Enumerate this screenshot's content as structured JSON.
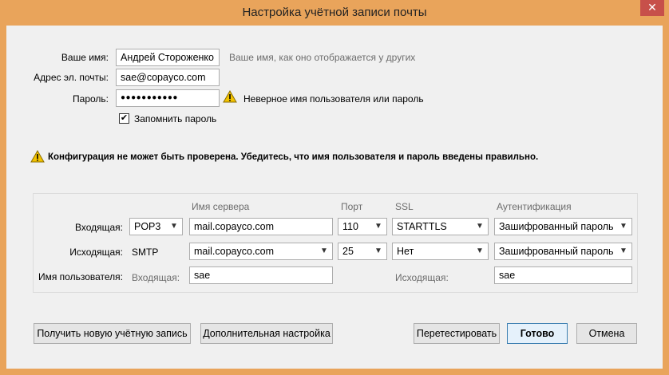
{
  "window": {
    "title": "Настройка учётной записи почты",
    "close_glyph": "✕"
  },
  "identity": {
    "name_label": "Ваше имя:",
    "name_value": "Андрей Стороженко",
    "name_hint": "Ваше имя, как оно отображается у других",
    "email_label": "Адрес эл. почты:",
    "email_value": "sae@copayco.com",
    "password_label": "Пароль:",
    "password_value": "●●●●●●●●●●●",
    "password_error": "Неверное имя пользователя или пароль",
    "remember_label": "Запомнить пароль",
    "remember_checked": true
  },
  "config_warning": "Конфигурация не может быть проверена. Убедитесь, что имя пользователя и пароль введены правильно.",
  "server_table": {
    "headers": {
      "server": "Имя сервера",
      "port": "Порт",
      "ssl": "SSL",
      "auth": "Аутентификация"
    },
    "incoming": {
      "label": "Входящая:",
      "protocol": "POP3",
      "server": "mail.copayco.com",
      "port": "110",
      "ssl": "STARTTLS",
      "auth": "Зашифрованный пароль"
    },
    "outgoing": {
      "label": "Исходящая:",
      "protocol": "SMTP",
      "server": "mail.copayco.com",
      "port": "25",
      "ssl": "Нет",
      "auth": "Зашифрованный пароль"
    },
    "username": {
      "label": "Имя пользователя:",
      "incoming_label": "Входящая:",
      "incoming_value": "sae",
      "outgoing_label": "Исходящая:",
      "outgoing_value": "sae"
    }
  },
  "buttons": {
    "new_account": "Получить новую учётную запись",
    "advanced": "Дополнительная настройка",
    "retest": "Перетестировать",
    "done": "Готово",
    "cancel": "Отмена"
  },
  "colors": {
    "title_bar": "#e9a45b",
    "close_button": "#c7504a",
    "warning": "#f2c200"
  }
}
